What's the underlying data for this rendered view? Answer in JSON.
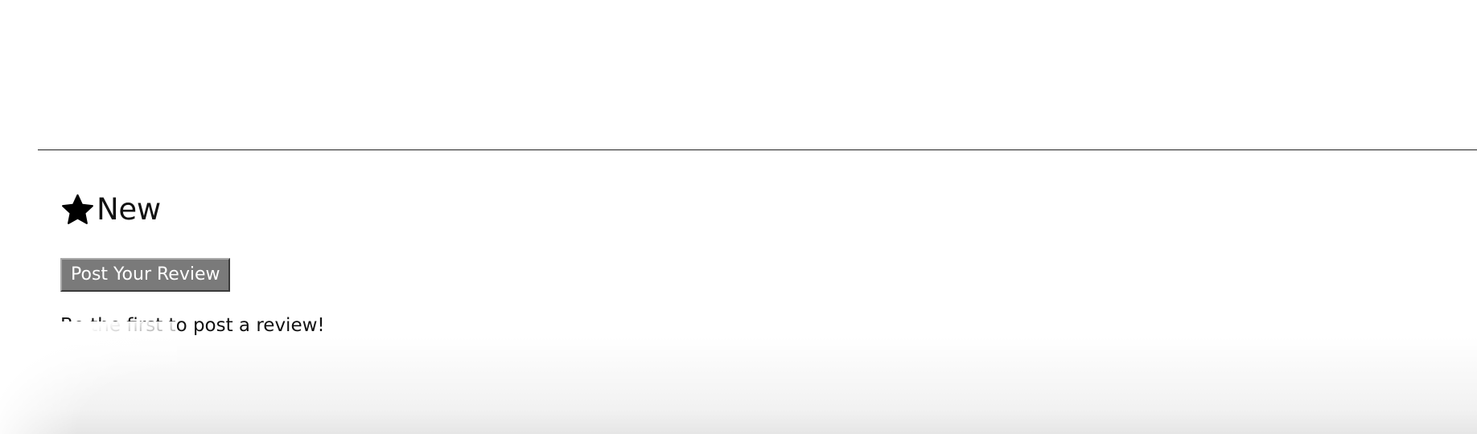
{
  "reviews": {
    "rating_label": "New",
    "rating_icon": "star-icon",
    "post_button_label": "Post Your Review",
    "empty_message": "Be the first to post a review!"
  },
  "colors": {
    "button_background": "#7a7a7a",
    "button_text": "#ffffff",
    "text": "#111111",
    "divider": "#222222"
  }
}
